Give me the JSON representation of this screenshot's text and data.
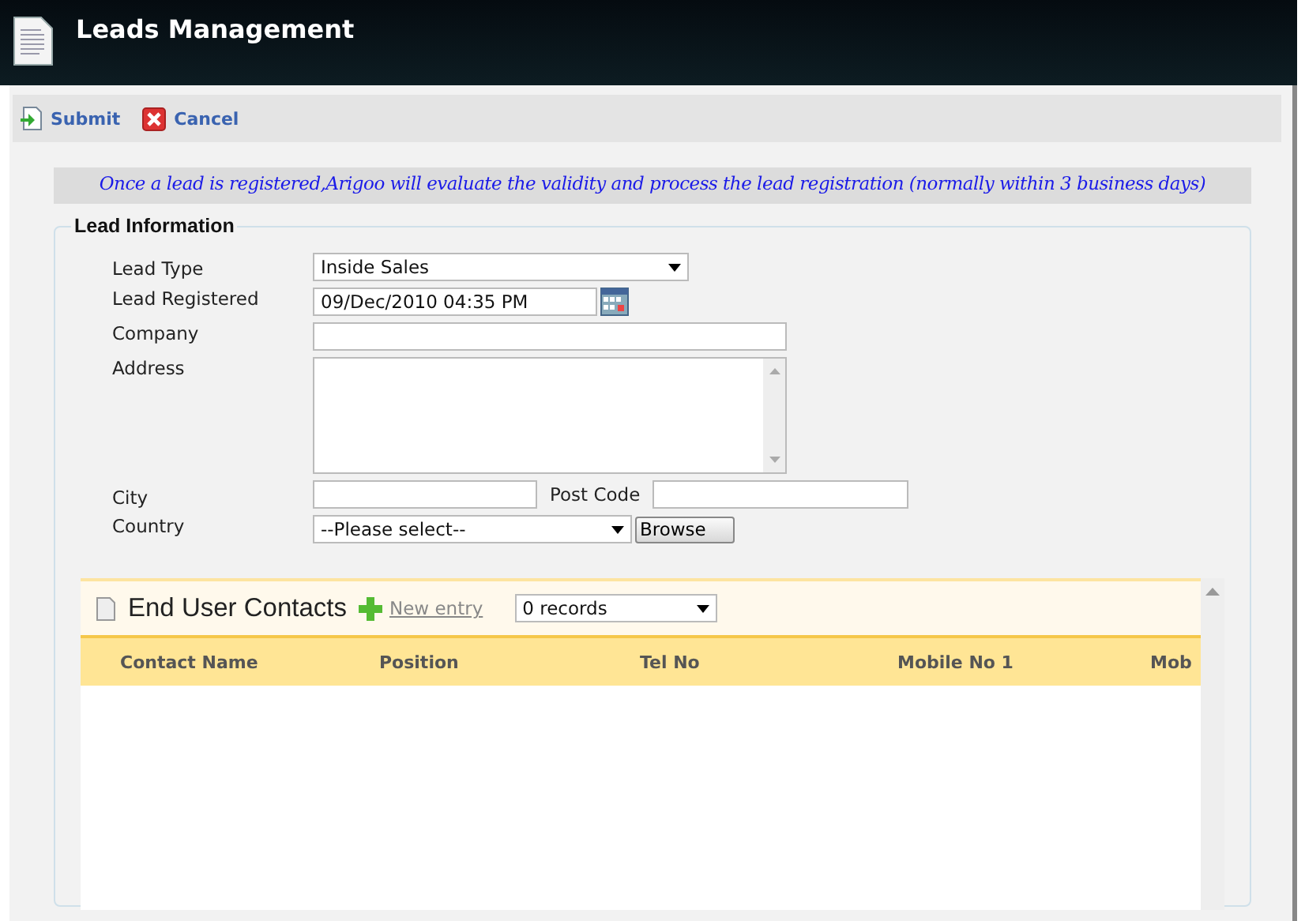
{
  "window": {
    "title": "Leads Management"
  },
  "toolbar": [
    {
      "label": "Submit",
      "kind": "submit"
    },
    {
      "label": "Cancel",
      "kind": "cancel"
    }
  ],
  "notice": "Once a lead is registered,Arigoo will evaluate the validity and process the lead registration (normally within 3 business days)",
  "lead_information": {
    "legend": "Lead Information",
    "fields": [
      {
        "label": "Lead Type",
        "kind": "select",
        "value": "Inside Sales"
      },
      {
        "label": "Lead Registered",
        "kind": "date",
        "value": "09/Dec/2010 04:35 PM"
      },
      {
        "label": "Company",
        "kind": "text"
      },
      {
        "label": "Address",
        "kind": "textarea"
      },
      {
        "label": "City",
        "kind": "city",
        "extra_label": "Post Code"
      },
      {
        "label": "Country",
        "kind": "country",
        "value": "--Please select--",
        "button": "Browse"
      }
    ]
  },
  "contacts": {
    "title": "End User Contacts",
    "new_entry": "New entry",
    "records": "0 records",
    "columns": [
      "Contact Name",
      "Position",
      "Tel No",
      "Mobile No 1",
      "Mob"
    ]
  }
}
